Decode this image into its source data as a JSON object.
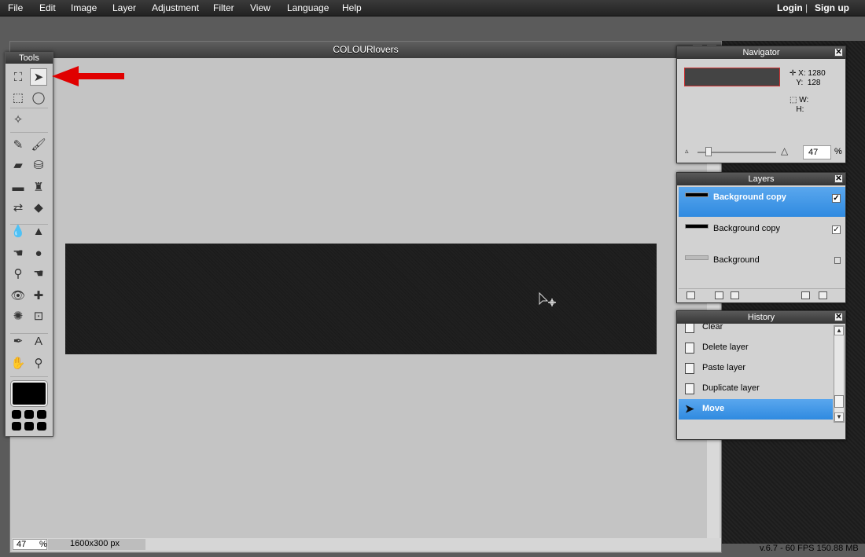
{
  "menu": {
    "items": [
      "File",
      "Edit",
      "Image",
      "Layer",
      "Adjustment",
      "Filter",
      "View",
      "Language",
      "Help"
    ],
    "login": "Login",
    "separator": "|",
    "signup": "Sign up"
  },
  "document": {
    "title": "COLOURlovers",
    "zoom": "47",
    "zoom_unit": "%",
    "size": "1600x300 px"
  },
  "tools": {
    "title": "Tools",
    "items": [
      {
        "name": "crop-icon",
        "glyph": "⛶"
      },
      {
        "name": "move-icon",
        "glyph": "➤",
        "active": true
      },
      {
        "name": "marquee-icon",
        "glyph": "⬚"
      },
      {
        "name": "lasso-icon",
        "glyph": "◯"
      },
      {
        "name": "magic-wand-icon",
        "glyph": "✧"
      },
      {
        "name": "pencil-icon",
        "glyph": "✎"
      },
      {
        "name": "brush-icon",
        "glyph": "🖌"
      },
      {
        "name": "eraser-icon",
        "glyph": "▰"
      },
      {
        "name": "paint-bucket-icon",
        "glyph": "⛁"
      },
      {
        "name": "gradient-icon",
        "glyph": "▬"
      },
      {
        "name": "clone-stamp-icon",
        "glyph": "♜"
      },
      {
        "name": "color-replace-icon",
        "glyph": "⇄"
      },
      {
        "name": "shape-icon",
        "glyph": "◆"
      },
      {
        "name": "blur-icon",
        "glyph": "💧"
      },
      {
        "name": "sharpen-icon",
        "glyph": "▲"
      },
      {
        "name": "smudge-icon",
        "glyph": "☚"
      },
      {
        "name": "sponge-icon",
        "glyph": "●"
      },
      {
        "name": "burn-icon",
        "glyph": "⚲"
      },
      {
        "name": "dodge-icon",
        "glyph": "☚"
      },
      {
        "name": "red-eye-icon",
        "glyph": "👁"
      },
      {
        "name": "spot-heal-icon",
        "glyph": "✚"
      },
      {
        "name": "bloat-icon",
        "glyph": "✺"
      },
      {
        "name": "pinch-icon",
        "glyph": "⊡"
      },
      {
        "name": "color-picker-icon",
        "glyph": "✒"
      },
      {
        "name": "type-icon",
        "glyph": "A"
      },
      {
        "name": "hand-icon",
        "glyph": "✋"
      },
      {
        "name": "zoom-icon",
        "glyph": "⚲"
      }
    ]
  },
  "navigator": {
    "title": "Navigator",
    "x_label": "X:",
    "x_value": "1280",
    "y_label": "Y:",
    "y_value": "128",
    "w_label": "W:",
    "h_label": "H:",
    "zoom": "47",
    "zoom_unit": "%"
  },
  "layers": {
    "title": "Layers",
    "items": [
      {
        "name": "Background copy",
        "visible": true,
        "selected": true
      },
      {
        "name": "Background copy",
        "visible": true,
        "selected": false
      },
      {
        "name": "Background",
        "locked": true,
        "selected": false
      }
    ]
  },
  "history": {
    "title": "History",
    "items": [
      {
        "label": "Clear"
      },
      {
        "label": "Delete layer"
      },
      {
        "label": "Paste layer"
      },
      {
        "label": "Duplicate layer"
      },
      {
        "label": "Move",
        "selected": true
      }
    ]
  },
  "status": {
    "version": "v.6.7 - 60 FPS 150.88 MB"
  },
  "colors": {
    "selection_blue": "#2f8ae0",
    "arrow_red": "#e00000",
    "canvas_bg": "#c4c4c4"
  }
}
